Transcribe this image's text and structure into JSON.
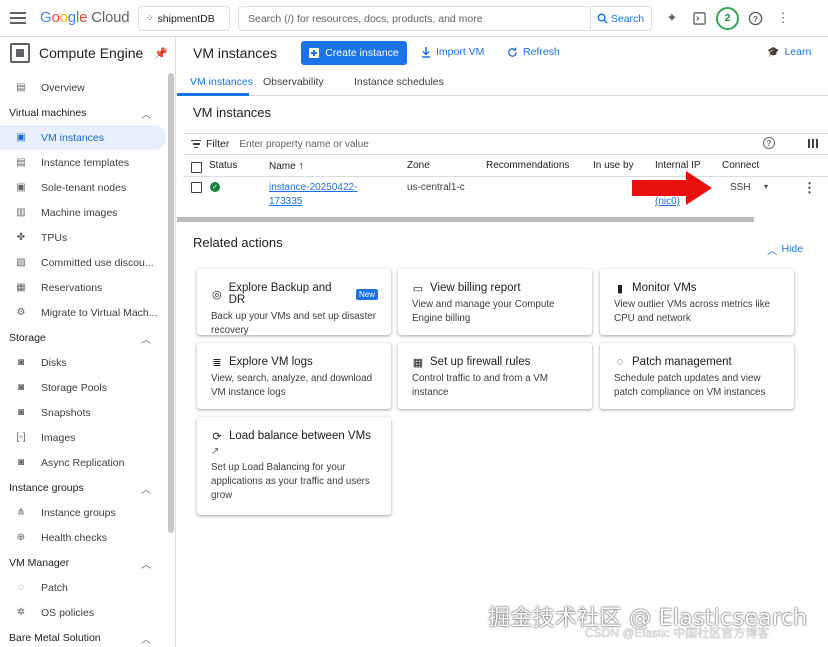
{
  "topbar": {
    "logo_google": [
      "G",
      "o",
      "o",
      "g",
      "l",
      "e"
    ],
    "logo_cloud": "Cloud",
    "project": "shipmentDB",
    "search_placeholder": "Search (/) for resources, docs, products, and more",
    "search_button": "Search",
    "notification_count": "2"
  },
  "sidebar": {
    "title": "Compute Engine",
    "items": [
      {
        "type": "item",
        "label": "Overview",
        "icon": "dashboard-icon"
      },
      {
        "type": "section",
        "label": "Virtual machines"
      },
      {
        "type": "item",
        "label": "VM instances",
        "icon": "vm-icon",
        "active": true
      },
      {
        "type": "item",
        "label": "Instance templates",
        "icon": "template-icon"
      },
      {
        "type": "item",
        "label": "Sole-tenant nodes",
        "icon": "node-icon"
      },
      {
        "type": "item",
        "label": "Machine images",
        "icon": "machine-image-icon"
      },
      {
        "type": "item",
        "label": "TPUs",
        "icon": "tpu-icon"
      },
      {
        "type": "item",
        "label": "Committed use discou...",
        "icon": "percent-icon"
      },
      {
        "type": "item",
        "label": "Reservations",
        "icon": "calendar-icon"
      },
      {
        "type": "item",
        "label": "Migrate to Virtual Mach...",
        "icon": "migrate-icon"
      },
      {
        "type": "section",
        "label": "Storage"
      },
      {
        "type": "item",
        "label": "Disks",
        "icon": "disk-icon"
      },
      {
        "type": "item",
        "label": "Storage Pools",
        "icon": "storage-pool-icon"
      },
      {
        "type": "item",
        "label": "Snapshots",
        "icon": "snapshot-icon"
      },
      {
        "type": "item",
        "label": "Images",
        "icon": "image-icon"
      },
      {
        "type": "item",
        "label": "Async Replication",
        "icon": "replication-icon"
      },
      {
        "type": "section",
        "label": "Instance groups"
      },
      {
        "type": "item",
        "label": "Instance groups",
        "icon": "group-icon"
      },
      {
        "type": "item",
        "label": "Health checks",
        "icon": "health-icon"
      },
      {
        "type": "section",
        "label": "VM Manager"
      },
      {
        "type": "item",
        "label": "Patch",
        "icon": "patch-icon"
      },
      {
        "type": "item",
        "label": "OS policies",
        "icon": "policy-icon"
      },
      {
        "type": "section",
        "label": "Bare Metal Solution"
      }
    ]
  },
  "header": {
    "title": "VM instances",
    "create_button": "Create instance",
    "import_button": "Import VM",
    "refresh_button": "Refresh",
    "learn_button": "Learn"
  },
  "tabs": [
    "VM instances",
    "Observability",
    "Instance schedules"
  ],
  "section_title": "VM instances",
  "filter": {
    "label": "Filter",
    "placeholder": "Enter property name or value"
  },
  "table": {
    "columns": [
      "Status",
      "Name",
      "Zone",
      "Recommendations",
      "In use by",
      "Internal IP",
      "Connect"
    ],
    "row": {
      "name_line1": "instance-20250422-",
      "name_line2": "173335",
      "zone": "us-central1-c",
      "ip_suffix": "(nic0)",
      "connect": "SSH"
    }
  },
  "related": {
    "title": "Related actions",
    "hide": "Hide",
    "cards": [
      {
        "title": "Explore Backup and DR",
        "badge": "New",
        "desc": "Back up your VMs and set up disaster recovery",
        "icon": "backup-icon"
      },
      {
        "title": "View billing report",
        "desc": "View and manage your Compute Engine billing",
        "icon": "billing-icon"
      },
      {
        "title": "Monitor VMs",
        "desc": "View outlier VMs across metrics like CPU and network",
        "icon": "chart-icon"
      },
      {
        "title": "Explore VM logs",
        "desc": "View, search, analyze, and download VM instance logs",
        "icon": "logs-icon"
      },
      {
        "title": "Set up firewall rules",
        "desc": "Control traffic to and from a VM instance",
        "icon": "firewall-icon"
      },
      {
        "title": "Patch management",
        "desc": "Schedule patch updates and view patch compliance on VM instances",
        "icon": "patch-icon"
      },
      {
        "title": "Load balance between VMs",
        "desc": "Set up Load Balancing for your applications as your traffic and users grow",
        "icon": "load-balance-icon"
      }
    ]
  },
  "watermark": {
    "line1": "掘金技术社区 @ Elasticsearch",
    "line2": "CSDN @Elastic 中国社区官方博客"
  },
  "colors": {
    "accent": "#1a73e8",
    "status_ok": "#188038",
    "arrow": "#e8100f"
  }
}
